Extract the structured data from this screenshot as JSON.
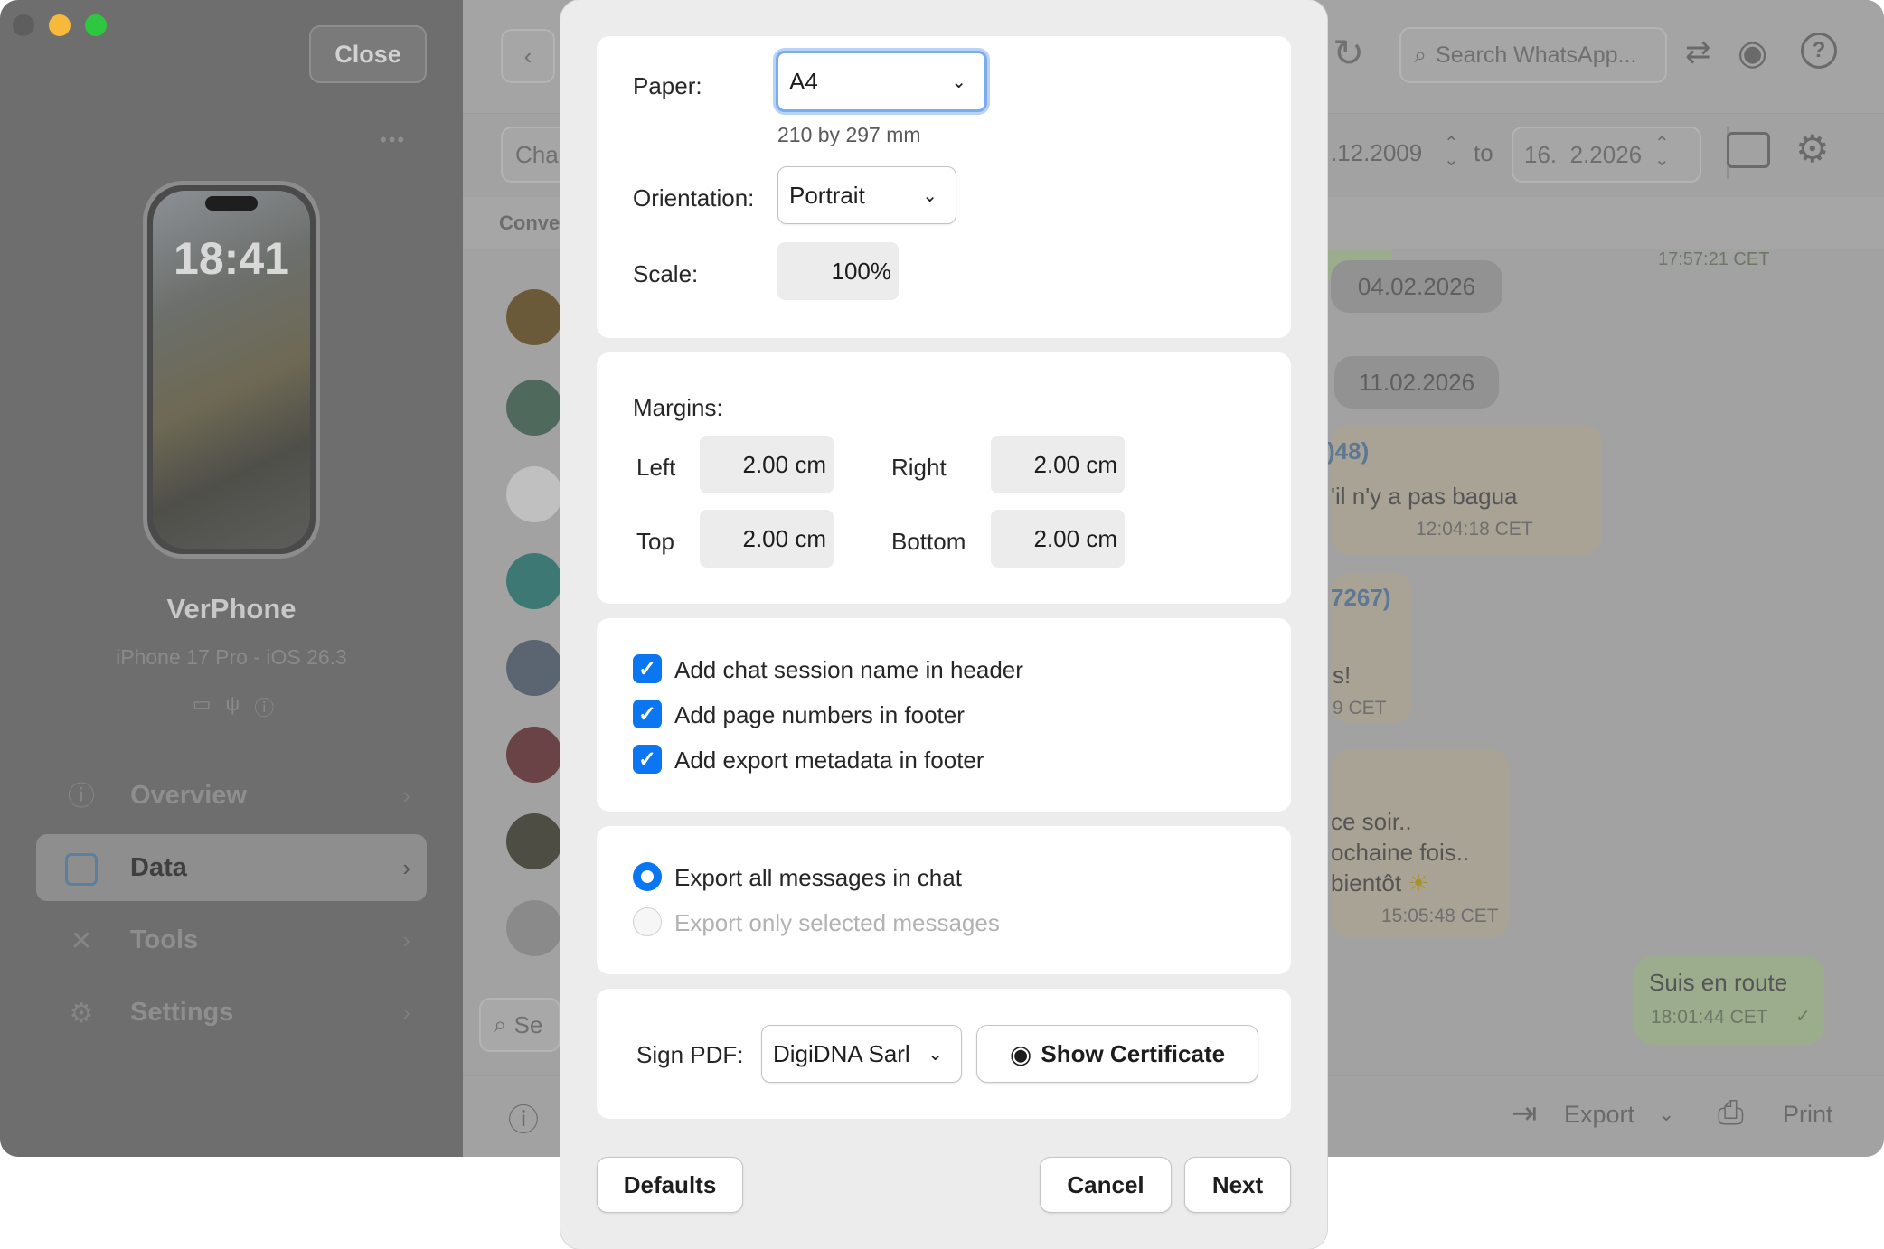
{
  "sidebar": {
    "close_label": "Close",
    "more_label": "•••",
    "phone_time": "18:41",
    "device_name": "VerPhone",
    "device_model": "iPhone 17 Pro - iOS 26.3",
    "nav": [
      {
        "label": "Overview",
        "icon": "info-circle-icon"
      },
      {
        "label": "Data",
        "icon": "square-icon"
      },
      {
        "label": "Tools",
        "icon": "tools-icon"
      },
      {
        "label": "Settings",
        "icon": "gear-icon"
      }
    ]
  },
  "main": {
    "search_placeholder": "Search WhatsApp...",
    "chats_tab_partial": "Cha",
    "conversations_partial": "Conve",
    "search_bottom_partial": "Se",
    "date_from": ".12.2009",
    "date_to_label": "to",
    "date_to": "16.  2.2026",
    "top_timestamp": "17:57:21 CET",
    "date_chip_1": "04.02.2026",
    "date_chip_2": "11.02.2026",
    "msg1_sender": ")48)",
    "msg1_text": "'il n'y a pas bagua",
    "msg1_time": "12:04:18 CET",
    "msg2_sender": "7267)",
    "msg2_text": "s!",
    "msg2_time": "9 CET",
    "msg3_line1": "ce soir..",
    "msg3_line2": "ochaine fois..",
    "msg3_line3": "bientôt",
    "msg3_time": "15:05:48 CET",
    "msg4_text": "Suis en route",
    "msg4_time": "18:01:44 CET",
    "export_label": "Export",
    "print_label": "Print"
  },
  "dialog": {
    "paper_label": "Paper:",
    "paper_value": "A4",
    "paper_size": "210 by 297 mm",
    "orientation_label": "Orientation:",
    "orientation_value": "Portrait",
    "scale_label": "Scale:",
    "scale_value": "100%",
    "margins_label": "Margins:",
    "left_label": "Left",
    "left_value": "2.00 cm",
    "right_label": "Right",
    "right_value": "2.00 cm",
    "top_label": "Top",
    "top_value": "2.00 cm",
    "bottom_label": "Bottom",
    "bottom_value": "2.00 cm",
    "checkboxes": [
      {
        "label": "Add chat session name in header",
        "checked": true
      },
      {
        "label": "Add page numbers in footer",
        "checked": true
      },
      {
        "label": "Add export metadata in footer",
        "checked": true
      }
    ],
    "radio_all": "Export all messages in chat",
    "radio_selected": "Export only selected messages",
    "sign_label": "Sign PDF:",
    "sign_value": "DigiDNA Sarl",
    "show_cert_label": "Show Certificate",
    "defaults_label": "Defaults",
    "cancel_label": "Cancel",
    "next_label": "Next"
  },
  "colors": {
    "accent": "#0a76f2",
    "dim_overlay": "#6e6e6e",
    "traffic_red": "#5e5e5e",
    "traffic_yellow": "#f6b93a",
    "traffic_green": "#2ec840"
  }
}
